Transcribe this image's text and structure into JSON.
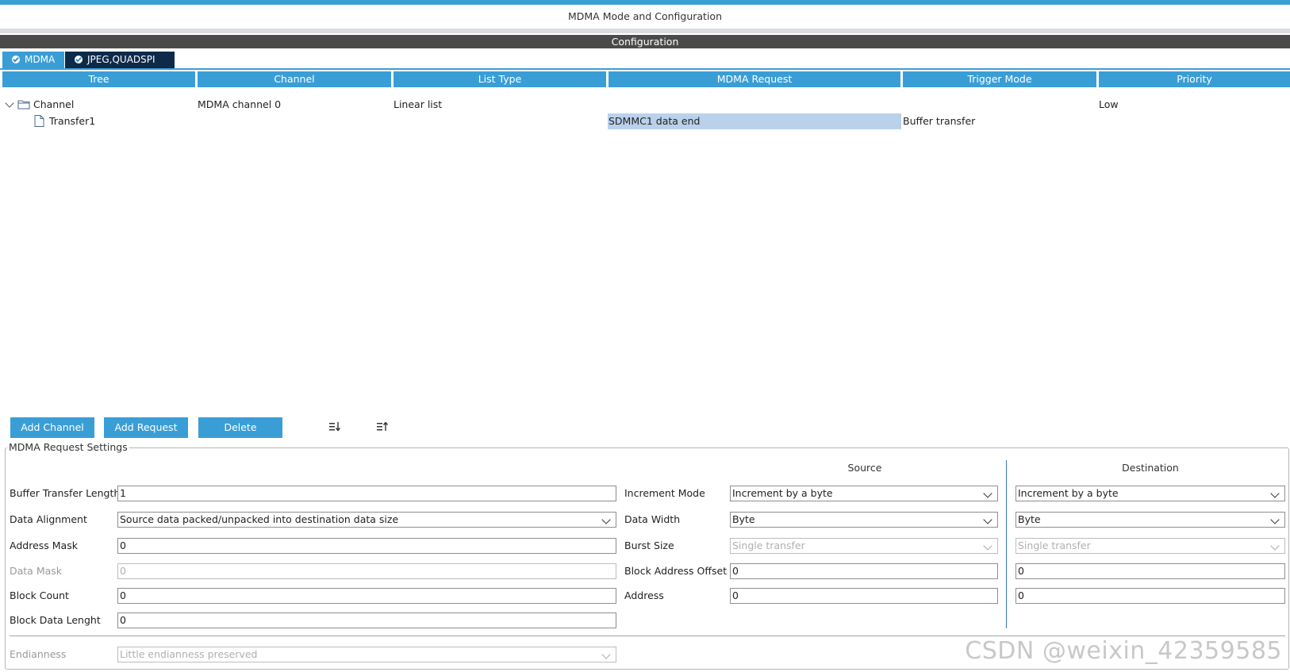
{
  "window": {
    "title": "MDMA Mode and Configuration"
  },
  "config_bar": {
    "label": "Configuration"
  },
  "tabs": [
    {
      "label": "MDMA",
      "state": "checked"
    },
    {
      "label": "JPEG,QUADSPI",
      "state": "checked"
    }
  ],
  "table": {
    "headers": [
      "Tree",
      "Channel",
      "List Type",
      "MDMA Request",
      "Trigger Mode",
      "Priority"
    ],
    "rows": [
      {
        "tree": "Channel",
        "channel": "MDMA channel 0",
        "list_type": "Linear list",
        "request": "",
        "trigger": "",
        "priority": "Low",
        "icon": "folder-icon"
      },
      {
        "tree": "Transfer1",
        "channel": "",
        "list_type": "",
        "request": "SDMMC1 data end",
        "trigger": "Buffer transfer",
        "priority": "",
        "icon": "document-icon"
      }
    ]
  },
  "buttons": {
    "add_channel": "Add Channel",
    "add_request": "Add Request",
    "delete": "Delete"
  },
  "settings": {
    "legend": "MDMA Request Settings",
    "source_header": "Source",
    "destination_header": "Destination",
    "left": {
      "buffer_transfer_length": {
        "label": "Buffer Transfer Length",
        "value": "1"
      },
      "data_alignment": {
        "label": "Data Alignment",
        "value": "Source data packed/unpacked into destination data size"
      },
      "address_mask": {
        "label": "Address Mask",
        "value": "0"
      },
      "data_mask": {
        "label": "Data Mask",
        "value": "0"
      },
      "block_count": {
        "label": "Block Count",
        "value": "0"
      },
      "block_data_length": {
        "label": "Block Data Lenght",
        "value": "0"
      },
      "endianness": {
        "label": "Endianness",
        "value": "Little endianness preserved"
      }
    },
    "middle_labels": {
      "increment_mode": "Increment Mode",
      "data_width": "Data Width",
      "burst_size": "Burst Size",
      "block_address_offset": "Block Address Offset",
      "address": "Address"
    },
    "source": {
      "increment_mode": "Increment by a byte",
      "data_width": "Byte",
      "burst_size": "Single transfer",
      "block_address_offset": "0",
      "address": "0"
    },
    "destination": {
      "increment_mode": "Increment by a byte",
      "data_width": "Byte",
      "burst_size": "Single transfer",
      "block_address_offset": "0",
      "address": "0"
    }
  },
  "watermark": "CSDN @weixin_42359585",
  "colors": {
    "accent": "#3a9ed6",
    "dark_tab": "#0e2a4a",
    "selection": "#b9d1ea"
  }
}
